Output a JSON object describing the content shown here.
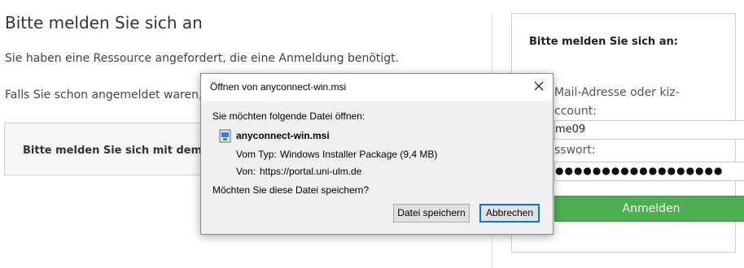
{
  "page": {
    "title": "Bitte melden Sie sich an",
    "para1": "Sie haben eine Ressource angefordert, die eine Anmeldung benötigt.",
    "para2": "Falls Sie schon angemeldet waren, i",
    "box_text": "Bitte melden Sie sich mit dem Fo"
  },
  "login": {
    "title": "Bitte melden Sie sich an:",
    "email_label": "Mail-Adresse oder kiz-\nccount:",
    "email_value": "me09",
    "password_label": "sswort:",
    "password_value": "●●●●●●●●●●●●●●●●●●",
    "button_label": "Anmelden"
  },
  "dialog": {
    "title": "Öffnen von anyconnect-win.msi",
    "question": "Sie möchten folgende Datei öffnen:",
    "file_name": "anyconnect-win.msi",
    "type_label": "Vom Typ:",
    "type_value": "Windows Installer Package (9,4 MB)",
    "from_label": "Von:",
    "from_value": "https://portal.uni-ulm.de",
    "save_question": "Möchten Sie diese Datei speichern?",
    "save_button": "Datei speichern",
    "cancel_button": "Abbrechen",
    "close_icon": "close-icon",
    "file_icon": "msi-file-icon"
  },
  "colors": {
    "login_button": "#4caf50",
    "dialog_focus": "#0078d7"
  }
}
